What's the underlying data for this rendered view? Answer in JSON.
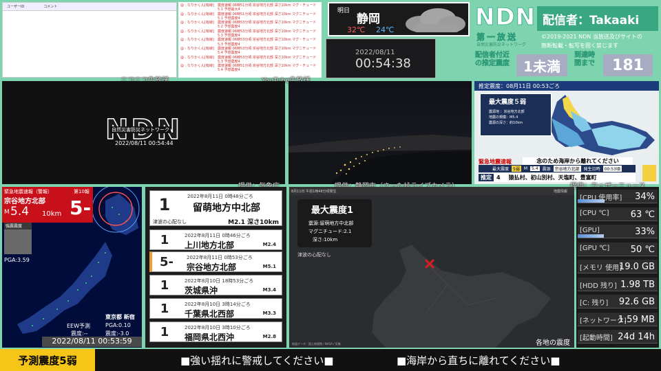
{
  "comments": {
    "col1": "ユーザーID",
    "col2": "コメント"
  },
  "tweets": [
    {
      "name": "@ : なりかくん[有線]",
      "text": "震度速報 06時51分頃 宗谷地方北部 深さ10km マグ・チュード5.1 予想最大4"
    },
    {
      "name": "@ : なりかくん[有線]",
      "text": "震度速報 06時51分頃 宗谷地方北部 深さ10km マグニチュード5.1 予想震度4"
    },
    {
      "name": "@ : なりかくん[有線]",
      "text": "震度速報 06時53分頃 宗谷地方北部 深さ10km マグニチュード5.2 予想震度4"
    },
    {
      "name": "@ : なりかくん[有線]",
      "text": "震度速報 06時53分頃 宗谷地方北部 深さ10km マグニチュード5.3 予想震度4"
    },
    {
      "name": "@ : なりかくん[有線]",
      "text": "震度速報 06時53分頃 宗谷地方北部 深さ10km マグ・チュード5.3 予想震度4"
    },
    {
      "name": "@ : なりかくん[有線]",
      "text": "震度速報 06時53分頃 宗谷地方北部 深さ10km マグニチュード5.4 予想震度4"
    },
    {
      "name": "@ : なりかくん[有線]",
      "text": "震度速報 06時53分頃 宗谷地方北部 深さ10km マグニチュード5.3 予想震度4"
    },
    {
      "name": "@ : なりかくん[有線]",
      "text": "震度速報 06時51分頃 宗谷地方北部 深さ10km マグ・チュード5.4 予想震度4"
    }
  ],
  "weather": {
    "day": "明日",
    "city": "静岡",
    "high": "32℃",
    "low": "24℃"
  },
  "clock": {
    "date": "2022/08/11",
    "time": "00:54:38"
  },
  "header": {
    "logo": "NDN",
    "streamer": "配信者：Takaaki",
    "first_report": "第一放送",
    "first_sub": "自然災害防災ネットワーク",
    "copyright": "©2019-2021 NDN 当放送及びサイトの",
    "copyright2": "無断転載・転写を固く禁じます",
    "est_label": "配信者付近の推定震度",
    "est_value": "1未満",
    "arrival_label": "到達時間まで",
    "arrival_value": "181"
  },
  "captions": {
    "niconico": "ニコニコ生放送",
    "youtube": "YouTube生放送",
    "jma": "提供：気象庁",
    "camera": "提供：静岡市（さった峠ライブカメラ）",
    "weathernews": "提供：ウェザーニュース"
  },
  "logo_panel": {
    "logo": "NDN",
    "subtitle": "自然災害防災ネットワーク",
    "timestamp": "2022/08/11 00:54:44"
  },
  "map1": {
    "title": "推定震度：08月11日 00:53ごろ",
    "max_label": "最大震度５弱",
    "info1": "震源地 ：宗谷地方北部",
    "info2": "地震の規模：M5.4",
    "info3": "震源の深さ：約10km",
    "eew_label": "緊急地震速報",
    "warn": "念のため海岸から離れてください",
    "row_max": "最大震度",
    "row_max_val": "5弱",
    "row_m": "M",
    "row_m_val": "5.4",
    "row_epi": "震源",
    "row_epi_val": "宗谷地方北部",
    "row_time": "発生日時",
    "row_time_val": "00:53頃",
    "est4": "推定",
    "est4_val": "4",
    "towns": "猿払村、初山別村、天塩町、豊富町"
  },
  "eew": {
    "title": "緊急地震速報（警報）",
    "num": "第10報",
    "region": "宗谷地方北部",
    "m_label": "M",
    "magnitude": "5.4",
    "depth": "10km",
    "intensity": "5-",
    "legend_title": "強震震度",
    "pga": "PGA:3.59",
    "station": "東京都 新宿",
    "eew_forecast": "EEW予測",
    "shindo_label": "震度:--",
    "pga2": "PGA:0.10",
    "shindo2": "震度:-3.0",
    "timestamp": "2022/08/11 00:53:59"
  },
  "quake_list": {
    "top": {
      "shindo": "1",
      "time": "2022年8月11日 0時48分ごろ",
      "region": "留萌地方中北部",
      "tsunami": "津波の心配なし",
      "mag_depth": "M2.1 深さ10km"
    },
    "items": [
      {
        "shindo": "1",
        "time": "2022年8月11日 0時46分ごろ",
        "region": "上川地方北部",
        "mag": "M2.4"
      },
      {
        "shindo": "5-",
        "time": "2022年8月11日 0時53分ごろ",
        "region": "宗谷地方北部",
        "mag": "M5.1"
      },
      {
        "shindo": "1",
        "time": "2022年8月10日 18時53分ごろ",
        "region": "茨城県沖",
        "mag": "M3.4"
      },
      {
        "shindo": "1",
        "time": "2022年8月10日 3時14分ごろ",
        "region": "千葉県北西部",
        "mag": "M3.3"
      },
      {
        "shindo": "1",
        "time": "2022年8月10日 3時10分ごろ",
        "region": "福岡県北西沖",
        "mag": "M2.8"
      }
    ]
  },
  "quake_map": {
    "header": "8月11日 午前1時48分頃発生",
    "header_right": "地震情報",
    "max": "最大震度1",
    "epi": "震源:留萌地方中北部",
    "mag": "マグニチュード:2.1",
    "depth": "深さ:10km",
    "tsunami": "津波の心配なし",
    "footer_left": "地図データ：国土地理院 / NASA / 気象",
    "footer_right": "各地の震度"
  },
  "system": [
    {
      "label": "[CPU 使用率]",
      "value": "34%",
      "bar": 0.34
    },
    {
      "label": "[CPU ℃]",
      "value": "63 ℃",
      "bar": 0
    },
    {
      "label": "[GPU]",
      "value": "33%",
      "bar": 0.33
    },
    {
      "label": "[GPU ℃]",
      "value": "50 ℃",
      "bar": 0
    },
    {
      "label": "[メモリ 使用]",
      "value": "19.0 GB",
      "bar": 0
    },
    {
      "label": "[HDD 残り]",
      "value": "1.98 TB",
      "bar": 0
    },
    {
      "label": "[C: 残り]",
      "value": "92.6 GB",
      "bar": 0
    },
    {
      "label": "[ネットワーク]",
      "value": "1.59 MB",
      "bar": 0
    },
    {
      "label": "[起動時間]",
      "value": "24d 14h",
      "bar": 0
    }
  ],
  "bottom": {
    "forecast": "予測震度5弱",
    "msg1": "■強い揺れに警戒してください■",
    "msg2": "■海岸から直ちに離れてください■"
  }
}
